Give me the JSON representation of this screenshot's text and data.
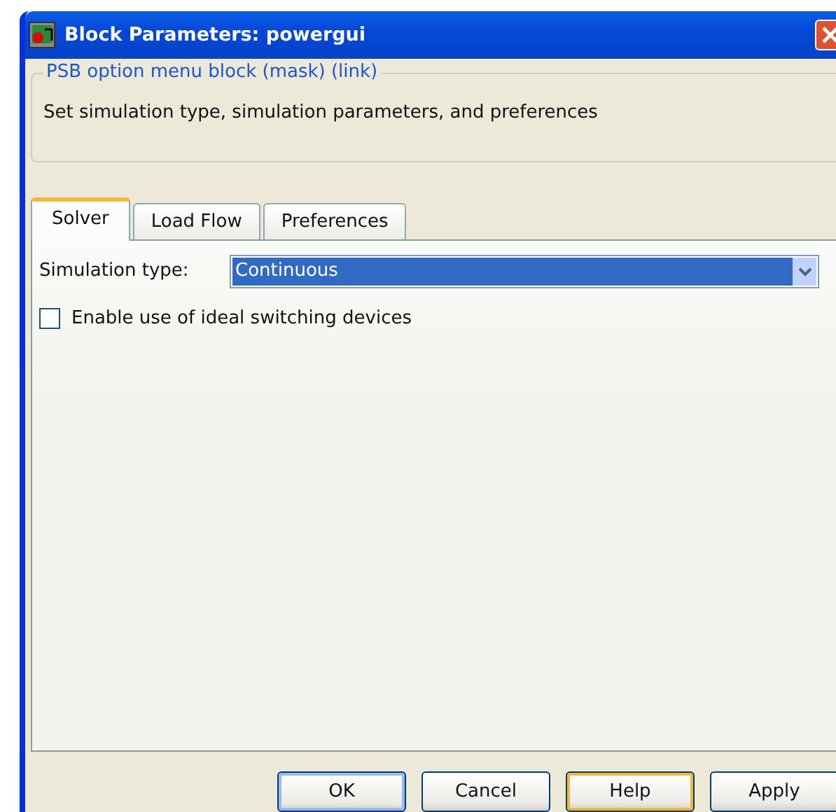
{
  "window": {
    "title": "Block Parameters: powergui"
  },
  "group": {
    "title": "PSB option menu block (mask) (link)",
    "description": "Set simulation type, simulation parameters, and preferences"
  },
  "tabs": [
    {
      "label": "Solver",
      "selected": true
    },
    {
      "label": "Load Flow",
      "selected": false
    },
    {
      "label": "Preferences",
      "selected": false
    }
  ],
  "simulation_type": {
    "label": "Simulation type:",
    "value": "Continuous"
  },
  "ideal_switching": {
    "label": "Enable use of ideal switching devices",
    "checked": false
  },
  "buttons": [
    {
      "label": "OK",
      "default": true,
      "focused": false
    },
    {
      "label": "Cancel",
      "default": false,
      "focused": false
    },
    {
      "label": "Help",
      "default": false,
      "focused": true
    },
    {
      "label": "Apply",
      "default": false,
      "focused": false
    }
  ]
}
